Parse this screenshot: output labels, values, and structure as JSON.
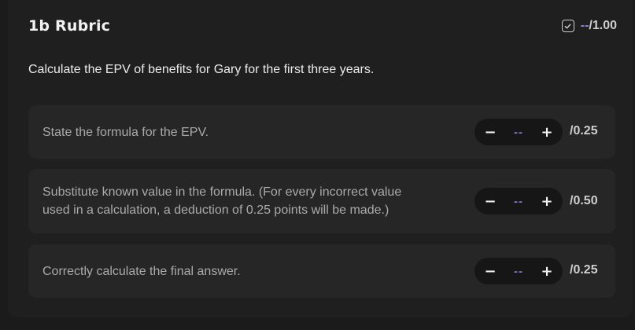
{
  "rubric": {
    "title": "1b Rubric",
    "score": "--",
    "score_total": "/1.00",
    "question": "Calculate the EPV of benefits for Gary for the first three years.",
    "criteria": [
      {
        "text": "State the formula for the EPV.",
        "value": "--",
        "max": "/0.25",
        "decrement": "−",
        "increment": "+"
      },
      {
        "text_line1": "Substitute known value in the formula. (For every incorrect value",
        "text_line2": "used in a calculation, a deduction of 0.25 points will be made.)",
        "value": "--",
        "max": "/0.50",
        "decrement": "−",
        "increment": "+"
      },
      {
        "text": "Correctly calculate the final answer.",
        "value": "--",
        "max": "/0.25",
        "decrement": "−",
        "increment": "+"
      }
    ]
  },
  "icons": {
    "score_checkbox": "check-square-icon"
  },
  "colors": {
    "background": "#1b1b1c",
    "panel": "#1f1f20",
    "criterion_card": "#262627",
    "stepper": "#161617",
    "accent_placeholder": "#8f86d9"
  }
}
